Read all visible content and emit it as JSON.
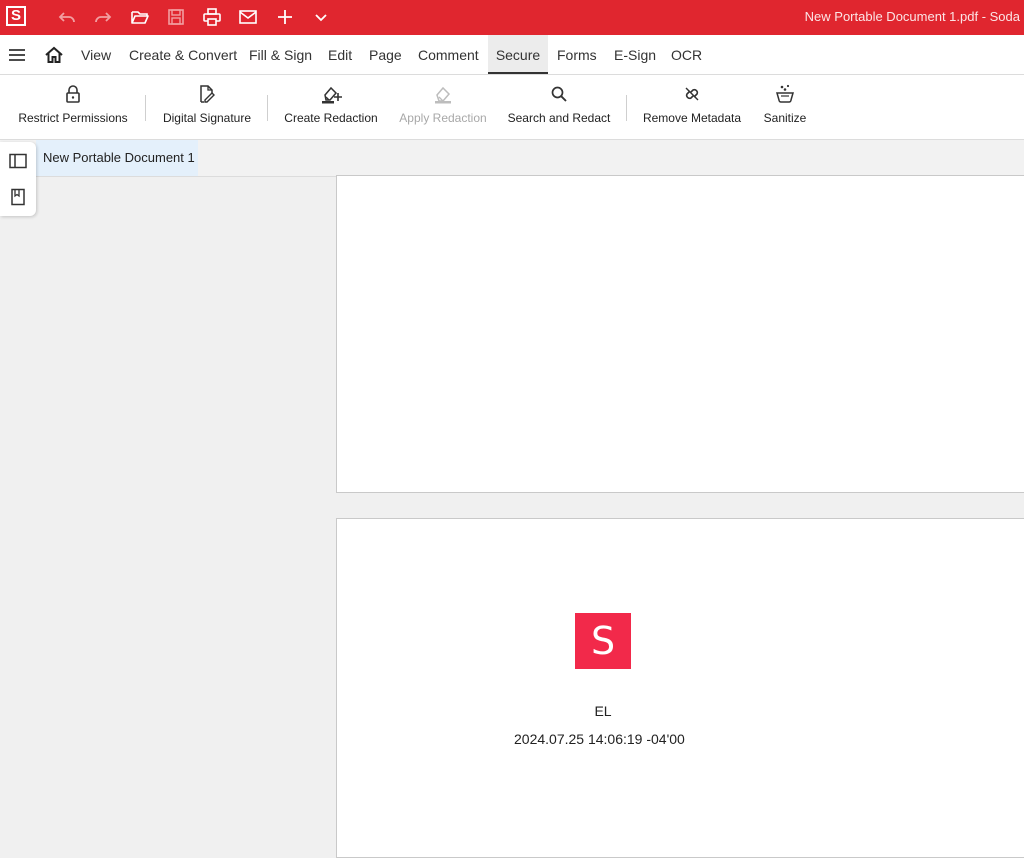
{
  "app": {
    "logo_letter": "S",
    "window_title": "New Portable Document 1.pdf  -  Soda",
    "brand_color": "#e0262f"
  },
  "quick_access": [
    "undo-icon",
    "redo-icon",
    "folder-open-icon",
    "save-icon",
    "print-icon",
    "mail-icon",
    "plus-icon",
    "chevron-down-icon"
  ],
  "menu": {
    "tabs": [
      {
        "label": "View"
      },
      {
        "label": "Create & Convert"
      },
      {
        "label": "Fill & Sign"
      },
      {
        "label": "Edit"
      },
      {
        "label": "Page"
      },
      {
        "label": "Comment"
      },
      {
        "label": "Secure"
      },
      {
        "label": "Forms"
      },
      {
        "label": "E-Sign"
      },
      {
        "label": "OCR"
      }
    ],
    "active_tab": "Secure"
  },
  "ribbon": {
    "restrict_permissions": "Restrict Permissions",
    "digital_signature": "Digital Signature",
    "create_redaction": "Create Redaction",
    "apply_redaction": "Apply Redaction",
    "search_and_redact": "Search and Redact",
    "remove_metadata": "Remove Metadata",
    "sanitize": "Sanitize"
  },
  "document_tab": {
    "label": "New Portable Document 1"
  },
  "signature": {
    "stamp_letter": "S",
    "stamp_color": "#f2294a",
    "name": "EL",
    "date": "2024.07.25 14:06:19 -04'00"
  }
}
